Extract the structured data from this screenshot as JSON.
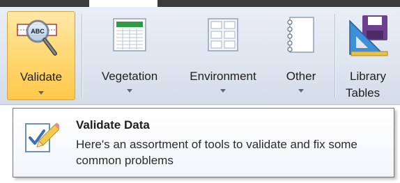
{
  "ribbon": {
    "buttons": [
      {
        "label": "Validate",
        "icon": "abc-magnifier-icon"
      },
      {
        "label": "Vegetation",
        "icon": "spreadsheet-icon"
      },
      {
        "label": "Environment",
        "icon": "grid-icon"
      },
      {
        "label": "Other",
        "icon": "notebook-icon"
      },
      {
        "label_line1": "Library",
        "label_line2": "Tables",
        "icon": "triangle-ruler-disk-icon"
      }
    ],
    "validate_icon_text": "ABC"
  },
  "tooltip": {
    "title": "Validate Data",
    "description": "Here's an assortment of tools to validate and fix some common problems",
    "icon": "checklist-pencil-icon"
  },
  "colors": {
    "highlight_top": "#ffe9a7",
    "highlight_bottom": "#ffc84a",
    "ribbon_bg": "#e9eef6",
    "tooltip_border": "#767676"
  }
}
